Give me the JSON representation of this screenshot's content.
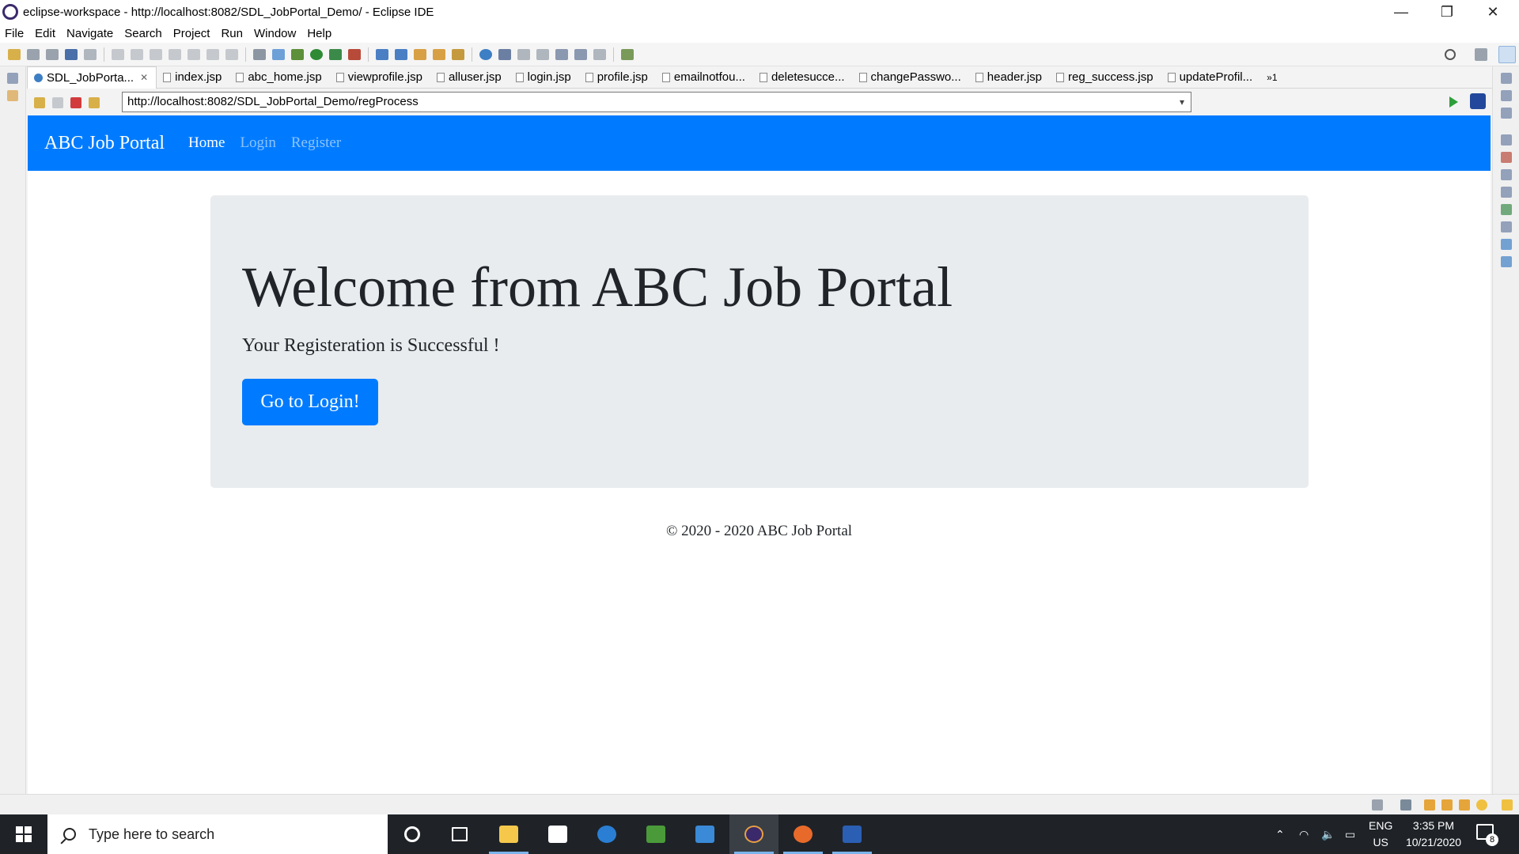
{
  "window": {
    "title": "eclipse-workspace - http://localhost:8082/SDL_JobPortal_Demo/ - Eclipse IDE",
    "controls": [
      "—",
      "❐",
      "✕"
    ]
  },
  "menu": [
    "File",
    "Edit",
    "Navigate",
    "Search",
    "Project",
    "Run",
    "Window",
    "Help"
  ],
  "tabs": [
    {
      "label": "SDL_JobPorta...",
      "icon": "globe-icon",
      "active": true
    },
    {
      "label": "index.jsp"
    },
    {
      "label": "abc_home.jsp"
    },
    {
      "label": "viewprofile.jsp"
    },
    {
      "label": "alluser.jsp"
    },
    {
      "label": "login.jsp"
    },
    {
      "label": "profile.jsp"
    },
    {
      "label": "emailnotfou..."
    },
    {
      "label": "deletesucce..."
    },
    {
      "label": "changePasswo..."
    },
    {
      "label": "header.jsp"
    },
    {
      "label": "reg_success.jsp"
    },
    {
      "label": "updateProfil..."
    }
  ],
  "tab_overflow": "»1",
  "address": {
    "url": "http://localhost:8082/SDL_JobPortal_Demo/regProcess"
  },
  "page": {
    "brand": "ABC Job Portal",
    "nav": [
      "Home",
      "Login",
      "Register"
    ],
    "heading": "Welcome from ABC Job Portal",
    "lead": "Your Registeration is Successful !",
    "button": "Go to Login!",
    "footer": "© 2020 - 2020 ABC Job Portal",
    "colors": {
      "primary": "#007bff",
      "jumbotron": "#e9ecef"
    }
  },
  "taskbar": {
    "search_placeholder": "Type here to search",
    "lang_line1": "ENG",
    "lang_line2": "US",
    "time": "3:35 PM",
    "date": "10/21/2020",
    "notifications": "8",
    "apps": [
      "task-view-icon",
      "file-explorer-icon",
      "store-icon",
      "edge-icon",
      "excel-like-icon",
      "mail-icon",
      "eclipse-icon",
      "firefox-icon",
      "word-icon"
    ]
  }
}
